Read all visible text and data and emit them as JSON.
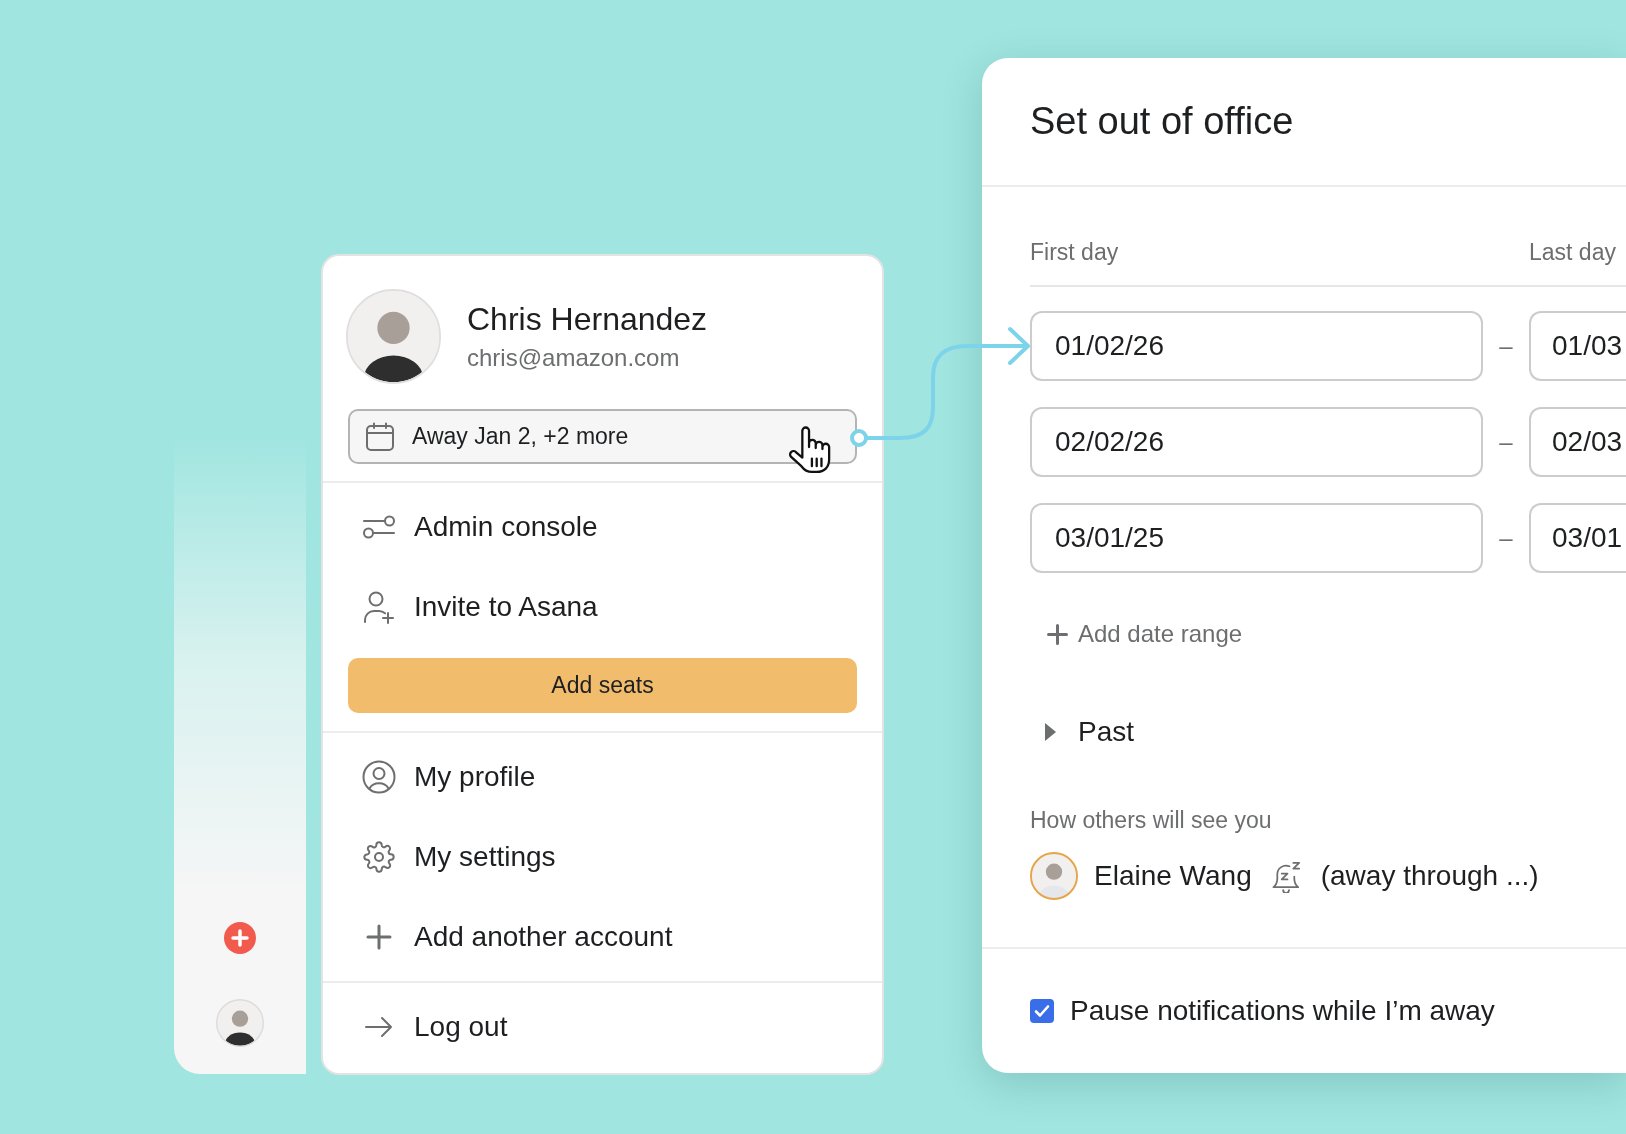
{
  "profile_menu": {
    "user": {
      "name": "Chris Hernandez",
      "email": "chris@amazon.com"
    },
    "status_button": {
      "label": "Away Jan 2, +2 more"
    },
    "sections": [
      {
        "items": [
          {
            "kind": "link",
            "label": "Admin console"
          },
          {
            "kind": "link",
            "label": "Invite to Asana"
          },
          {
            "kind": "button",
            "label": "Add seats"
          }
        ]
      },
      {
        "items": [
          {
            "kind": "link",
            "label": "My profile"
          },
          {
            "kind": "link",
            "label": "My settings"
          },
          {
            "kind": "link",
            "label": "Add another account"
          }
        ]
      },
      {
        "items": [
          {
            "kind": "link",
            "label": "Log out"
          }
        ]
      }
    ]
  },
  "out_of_office": {
    "title": "Set out of office",
    "columns": [
      "First day",
      "Last day"
    ],
    "ranges": [
      {
        "first": "01/02/26",
        "separator": "–",
        "last": "01/03"
      },
      {
        "first": "02/02/26",
        "separator": "–",
        "last": "02/03"
      },
      {
        "first": "03/01/25",
        "separator": "–",
        "last": "03/01"
      }
    ],
    "add_range": {
      "label": "Add date range"
    },
    "past": {
      "label": "Past",
      "expanded": false
    },
    "preview": {
      "heading": "How others will see you",
      "name": "Elaine Wang",
      "status": "(away through ...)"
    },
    "pause_notifications": {
      "label": "Pause notifications while I’m away",
      "checked": true
    }
  }
}
